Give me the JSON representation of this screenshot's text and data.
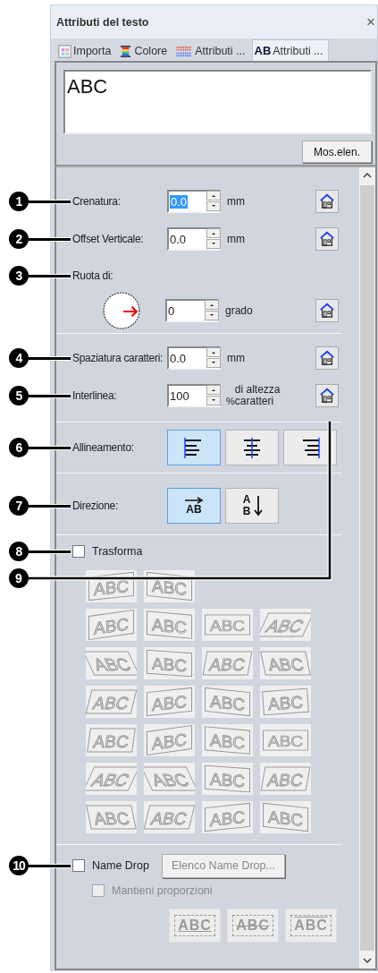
{
  "window": {
    "title": "Attributi del testo",
    "close": "×"
  },
  "tabs": [
    {
      "label": "Importa",
      "selected": false
    },
    {
      "label": "Colore",
      "selected": false
    },
    {
      "label": "Attributi ...",
      "selected": false
    },
    {
      "label": "Attributi ...",
      "selected": true,
      "icon_text": "AB"
    }
  ],
  "preview": {
    "value": "ABC"
  },
  "list_button": "Mos.elen.",
  "groups": [
    [
      {
        "kind": "spin",
        "callout": "1",
        "label": "Crenatura:",
        "value": "0.0",
        "highlighted": true,
        "unit": "mm"
      },
      {
        "kind": "spin",
        "callout": "2",
        "label": "Offset Verticale:",
        "value": "0.0",
        "highlighted": false,
        "unit": "mm"
      },
      {
        "kind": "rotate",
        "callout": "3",
        "label": "Ruota di:",
        "value": "0",
        "highlighted": false,
        "unit": "grado"
      }
    ],
    [
      {
        "kind": "spin",
        "callout": "4",
        "label": "Spaziatura caratteri:",
        "value": "0.0",
        "highlighted": false,
        "unit": "mm"
      },
      {
        "kind": "spin",
        "callout": "5",
        "label": "Interlinea:",
        "value": "100",
        "highlighted": false,
        "unit": "%",
        "unit_note": "di altezza caratteri"
      }
    ],
    [
      {
        "kind": "align",
        "callout": "6",
        "label": "Allineamento:",
        "options": [
          {
            "kind": "left",
            "selected": true
          },
          {
            "kind": "center",
            "selected": false
          },
          {
            "kind": "right",
            "selected": false
          }
        ]
      }
    ],
    [
      {
        "kind": "direction",
        "callout": "7",
        "label": "Direzione:",
        "options": [
          {
            "label": "AB",
            "kind": "horizontal",
            "selected": true
          },
          {
            "label": "AB",
            "kind": "vertical",
            "selected": false
          }
        ]
      }
    ],
    [
      {
        "kind": "transform",
        "callout": "8",
        "label": "Trasforma",
        "checked": false,
        "leader_callout": "9",
        "disabled": true,
        "style_rows": [
          [
            {
              "label": "ABC"
            },
            {
              "label": "ABC"
            }
          ],
          [
            {
              "label": "ABC"
            },
            {
              "label": "ABC"
            },
            {
              "label": "ABC"
            },
            {
              "label": "ABC"
            }
          ],
          [
            {
              "label": "ABC"
            },
            {
              "label": "ABC"
            },
            {
              "label": "ABC"
            },
            {
              "label": "ABC"
            }
          ],
          [
            {
              "label": "ABC"
            },
            {
              "label": "ABC"
            },
            {
              "label": "ABC"
            },
            {
              "label": "ABC"
            }
          ],
          [
            {
              "label": "ABC"
            },
            {
              "label": "ABC"
            },
            {
              "label": "ABC"
            },
            {
              "label": "ABC"
            }
          ],
          [
            {
              "label": "ABC"
            },
            {
              "label": "ABC"
            },
            {
              "label": "ABC"
            },
            {
              "label": "ABC"
            }
          ],
          [
            {
              "label": "ABC"
            },
            {
              "label": "ABC"
            },
            {
              "label": "ABC"
            },
            {
              "label": "ABC"
            }
          ]
        ]
      }
    ],
    [
      {
        "kind": "namedrop",
        "callout": "10",
        "label": "Name Drop",
        "checked": false,
        "button": "Elenco Name Drop...",
        "button_disabled": true,
        "keep": {
          "label": "Mantieni proporzioni",
          "checked": false,
          "disabled": true
        },
        "styles": [
          {
            "label": "ABC",
            "kind": "under"
          },
          {
            "label": "ABC",
            "kind": "through"
          },
          {
            "label": "ABC",
            "kind": "over"
          }
        ]
      }
    ]
  ]
}
